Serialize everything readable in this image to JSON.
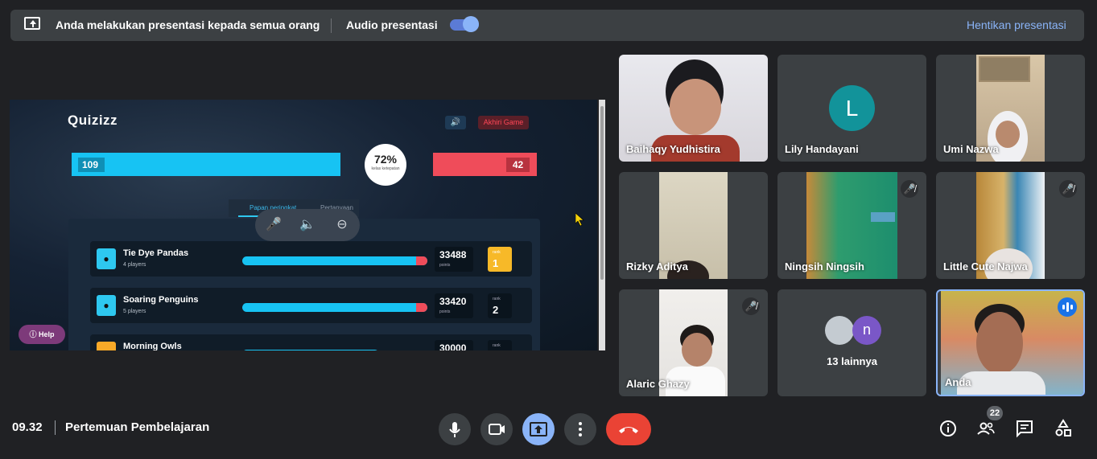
{
  "topbar": {
    "message": "Anda melakukan presentasi kepada semua orang",
    "audio_label": "Audio presentasi",
    "audio_enabled": true,
    "stop_label": "Hentikan presentasi"
  },
  "shared_screen": {
    "logo": "Quizizz",
    "end_game_label": "Akhiri Game",
    "score_left": "109",
    "score_right": "42",
    "accuracy": "72%",
    "accuracy_caption": "kelas ketepatan",
    "tabs": [
      "Papan peringkat",
      "Pertanyaan"
    ],
    "help_label": "Help",
    "teams": [
      {
        "name": "Tie Dye Pandas",
        "players": "4 players",
        "points": "33488",
        "points_label": "points",
        "rank_label": "rank",
        "rank": "1"
      },
      {
        "name": "Soaring Penguins",
        "players": "5 players",
        "points": "33420",
        "points_label": "points",
        "rank_label": "rank",
        "rank": "2"
      },
      {
        "name": "Morning Owls",
        "players": "",
        "points": "30000",
        "points_label": "",
        "rank_label": "rank",
        "rank": ""
      }
    ]
  },
  "participants": [
    {
      "name": "Baihaqy Yudhistira",
      "muted": false
    },
    {
      "name": "Lily Handayani",
      "initial": "L",
      "muted": false
    },
    {
      "name": "Umi Nazwa",
      "muted": false
    },
    {
      "name": "Rizky Aditya",
      "muted": false
    },
    {
      "name": "Ningsih Ningsih",
      "muted": true
    },
    {
      "name": "Little Cute Najwa",
      "muted": true
    },
    {
      "name": "Alaric Ghazy",
      "muted": true
    },
    {
      "name": "13 lainnya",
      "initial": "n",
      "muted": false
    },
    {
      "name": "Anda",
      "muted": false,
      "speaking": true
    }
  ],
  "bottombar": {
    "time": "09.32",
    "meeting_title": "Pertemuan Pembelajaran",
    "participant_count": "22"
  },
  "colors": {
    "accent": "#8ab4f8",
    "hangup": "#ea4335",
    "quiz_blue": "#17c3f3",
    "quiz_red": "#ef4c5a"
  }
}
